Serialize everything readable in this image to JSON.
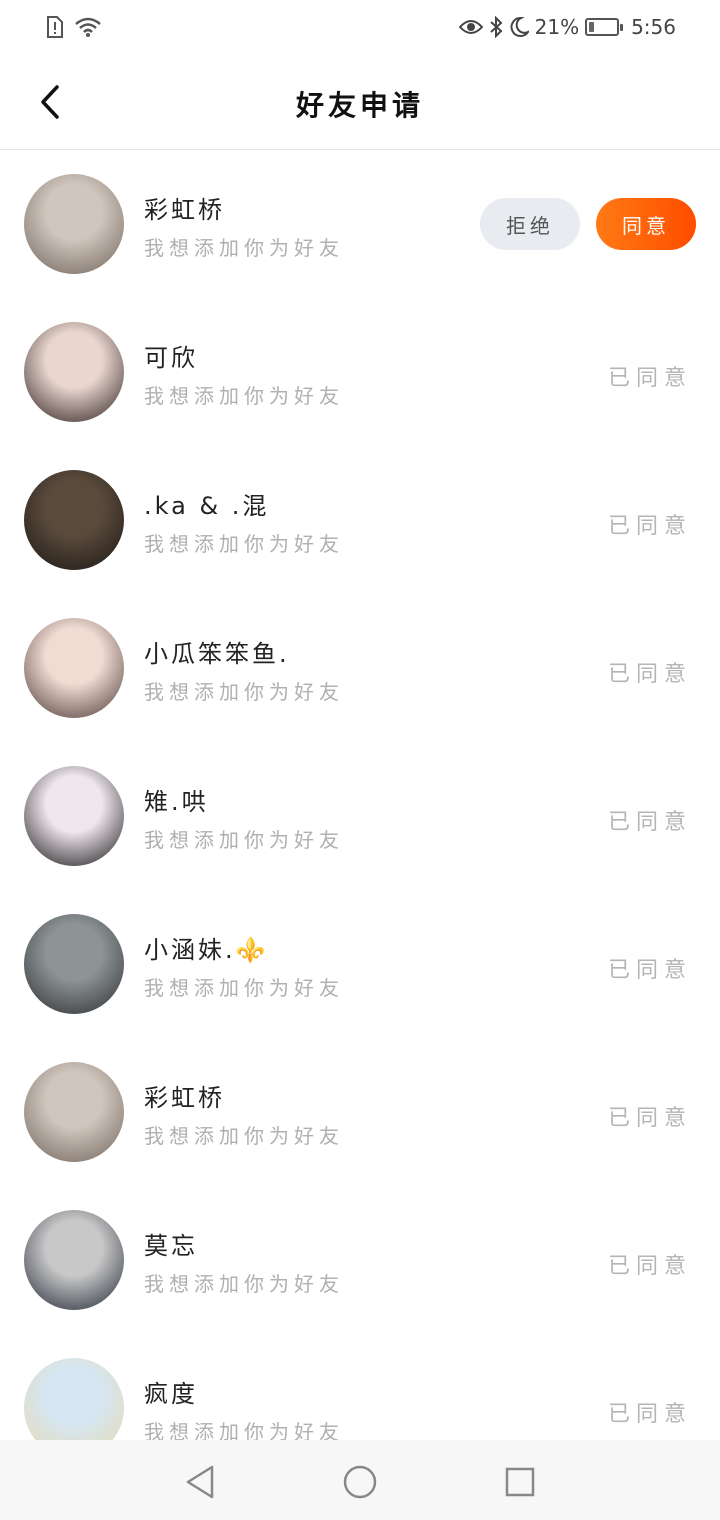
{
  "status_bar": {
    "left_icons": [
      "sim-alert-icon",
      "wifi-icon"
    ],
    "right_icons": [
      "eye-icon",
      "bluetooth-icon",
      "moon-icon"
    ],
    "battery_text": "21%",
    "battery_level": 0.21,
    "time": "5:56"
  },
  "header": {
    "title": "好友申请",
    "back_icon": "chevron-left-icon"
  },
  "requests": [
    {
      "name": "彩虹桥",
      "message": "我想添加你为好友",
      "state": "pending",
      "reject_label": "拒绝",
      "agree_label": "同意",
      "avatar_colors": [
        "#cfc6bd",
        "#6f6259"
      ]
    },
    {
      "name": "可欣",
      "message": "我想添加你为好友",
      "state": "accepted",
      "status_label": "已同意",
      "avatar_colors": [
        "#e9d6cf",
        "#2a1d1c"
      ]
    },
    {
      "name": ".ka & .混",
      "message": "我想添加你为好友",
      "state": "accepted",
      "status_label": "已同意",
      "avatar_colors": [
        "#5a4a3c",
        "#1b1714"
      ]
    },
    {
      "name": "小瓜笨笨鱼.",
      "message": "我想添加你为好友",
      "state": "accepted",
      "status_label": "已同意",
      "avatar_colors": [
        "#f0dcd3",
        "#4a3733"
      ]
    },
    {
      "name": "雉.哄",
      "message": "我想添加你为好友",
      "state": "accepted",
      "status_label": "已同意",
      "avatar_colors": [
        "#efe6ee",
        "#121212"
      ]
    },
    {
      "name": "小涵妹.⚜️",
      "message": "我想添加你为好友",
      "state": "accepted",
      "status_label": "已同意",
      "avatar_colors": [
        "#8e9496",
        "#2b2d30"
      ]
    },
    {
      "name": "彩虹桥",
      "message": "我想添加你为好友",
      "state": "accepted",
      "status_label": "已同意",
      "avatar_colors": [
        "#cfc6bd",
        "#6f6259"
      ]
    },
    {
      "name": "莫忘",
      "message": "我想添加你为好友",
      "state": "accepted",
      "status_label": "已同意",
      "avatar_colors": [
        "#c8c8c8",
        "#202633"
      ]
    },
    {
      "name": "疯度",
      "message": "我想添加你为好友",
      "state": "accepted",
      "status_label": "已同意",
      "avatar_colors": [
        "#d6e6f2",
        "#e6d9b0"
      ]
    }
  ],
  "nav_bar": {
    "icons": [
      "back-triangle-icon",
      "home-circle-icon",
      "recents-square-icon"
    ]
  },
  "colors": {
    "accent_start": "#ff7a14",
    "accent_end": "#ff4d00",
    "reject_bg": "#e8ebf0",
    "muted_text": "#b0b0b0"
  }
}
